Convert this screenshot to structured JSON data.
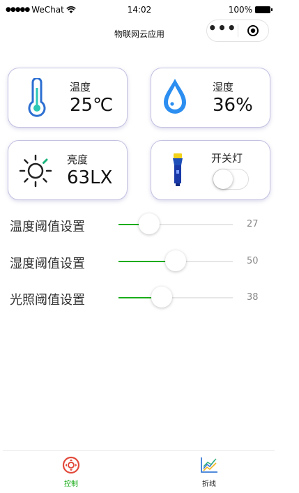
{
  "statusbar": {
    "carrier": "WeChat",
    "time": "14:02",
    "battery": "100%"
  },
  "navbar": {
    "title": "物联网云应用"
  },
  "cards": {
    "temperature": {
      "label": "温度",
      "value": "25℃",
      "icon": "thermometer-icon"
    },
    "humidity": {
      "label": "湿度",
      "value": "36%",
      "icon": "water-drop-icon"
    },
    "brightness": {
      "label": "亮度",
      "value": "63LX",
      "icon": "sun-icon"
    },
    "lamp": {
      "label": "开关灯",
      "icon": "flashlight-icon",
      "switch_on": false
    }
  },
  "sliders": [
    {
      "label": "温度阈值设置",
      "value": 27,
      "max": 100
    },
    {
      "label": "湿度阈值设置",
      "value": 50,
      "max": 100
    },
    {
      "label": "光照阈值设置",
      "value": 38,
      "max": 100
    }
  ],
  "tabbar": {
    "items": [
      {
        "label": "控制",
        "icon": "control-icon",
        "active": true
      },
      {
        "label": "折线",
        "icon": "line-chart-icon",
        "active": false
      }
    ],
    "active_color": "#1aad19",
    "inactive_color": "#222222"
  }
}
